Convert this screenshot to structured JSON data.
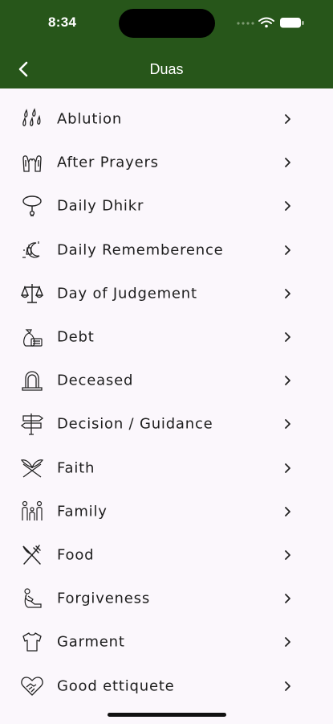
{
  "status_bar": {
    "time": "8:34"
  },
  "nav": {
    "title": "Duas",
    "back_icon": "chevron-left-icon"
  },
  "items": [
    {
      "label": "Ablution",
      "icon": "water-drops-icon"
    },
    {
      "label": "After Prayers",
      "icon": "praying-hands-icon"
    },
    {
      "label": "Daily Dhikr",
      "icon": "prayer-beads-icon"
    },
    {
      "label": "Daily Rememberence",
      "icon": "moon-lantern-icon"
    },
    {
      "label": "Day of Judgement",
      "icon": "scales-icon"
    },
    {
      "label": "Debt",
      "icon": "money-bag-icon"
    },
    {
      "label": "Deceased",
      "icon": "gravestone-icon"
    },
    {
      "label": "Decision / Guidance",
      "icon": "signpost-icon"
    },
    {
      "label": "Faith",
      "icon": "quran-stand-icon"
    },
    {
      "label": "Family",
      "icon": "family-icon"
    },
    {
      "label": "Food",
      "icon": "fork-knife-icon"
    },
    {
      "label": "Forgiveness",
      "icon": "kneeling-person-icon"
    },
    {
      "label": "Garment",
      "icon": "shirt-icon"
    },
    {
      "label": "Good ettiquete",
      "icon": "heart-handshake-icon"
    }
  ],
  "colors": {
    "header": "#27561a",
    "background": "#fbf7fc"
  }
}
